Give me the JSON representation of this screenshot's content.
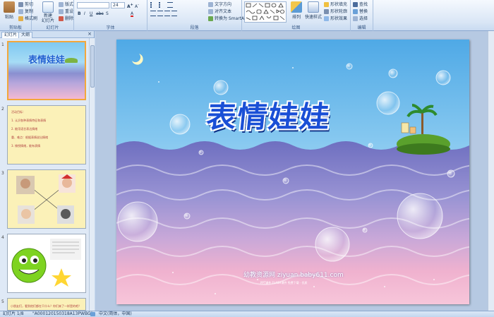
{
  "ribbon": {
    "clipboard": {
      "paste": "粘贴",
      "cut": "剪切",
      "copy": "复制",
      "format_painter": "格式刷",
      "label": "剪贴板"
    },
    "slides": {
      "new_slide": "新建\n幻灯片",
      "layout": "版式",
      "reset": "重设",
      "delete": "删除",
      "label": "幻灯片"
    },
    "font": {
      "font_name": "",
      "font_size": "24",
      "label": "字体"
    },
    "paragraph": {
      "text_direction": "文字方向",
      "align_text": "对齐文本",
      "smartart": "转换为 SmartArt",
      "label": "段落"
    },
    "drawing": {
      "arrange": "排列",
      "quick_styles": "快速样式",
      "shape_fill": "形状填充",
      "shape_outline": "形状轮廓",
      "shape_effects": "形状效果",
      "label": "绘图"
    },
    "editing": {
      "find": "查找",
      "replace": "替换",
      "select": "选择",
      "label": "编辑"
    }
  },
  "pane": {
    "tab_slides": "幻灯片",
    "tab_outline": "大纲",
    "close": "×",
    "slides": [
      {
        "num": "1",
        "title": "表情娃娃"
      },
      {
        "num": "2",
        "lines": [
          "活动目标：",
          "1. 认识各种表情特征和表情",
          "2. 能用语言表达情绪",
          "重、难点：根据表情说出情绪",
          "3. 愉悦情绪，能有表情"
        ]
      },
      {
        "num": "3"
      },
      {
        "num": "4"
      },
      {
        "num": "5",
        "text": "小朋友们，看到他们都在干什么？你们来了一样是的吧？"
      }
    ]
  },
  "slide": {
    "title": "表情娃娃",
    "watermark": "幼教资源网 ziyuan.baby611.com",
    "sub": "PPT课件  FLASH课件  免费下载  ·  优质"
  },
  "status": {
    "slide_pos": "幻灯片 1/8",
    "theme": "\"A000120150318A13PWBG\"",
    "language": "中文(简体，中国)"
  },
  "colors": {
    "accent": "#1e395b",
    "sky": "#5fb3ea",
    "sea": "#8086c8",
    "pink": "#f2b5cf"
  }
}
